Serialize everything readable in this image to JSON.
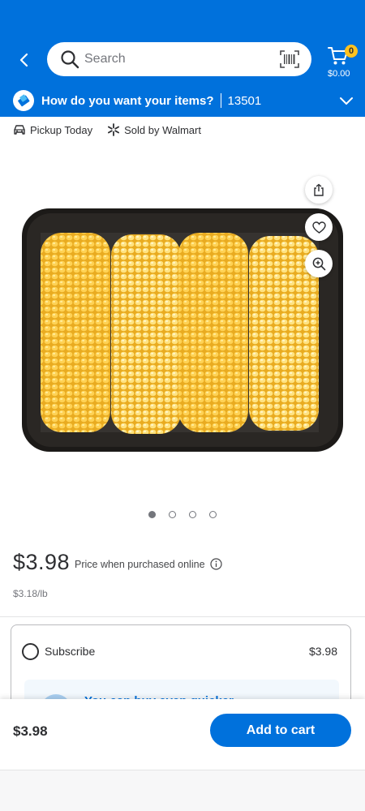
{
  "header": {
    "search_placeholder": "Search",
    "cart_count": "0",
    "cart_total": "$0.00"
  },
  "fulfillment": {
    "question": "How do you want your items?",
    "zip": "13501"
  },
  "info": {
    "pickup": "Pickup Today",
    "sold_by": "Sold by Walmart"
  },
  "gallery": {
    "image_count": 4,
    "active_index": 0,
    "icons": [
      "share-icon",
      "heart-icon",
      "zoom-icon"
    ]
  },
  "pricing": {
    "price": "$3.98",
    "note": "Price when purchased online",
    "unit_price": "$3.18/lb"
  },
  "subscribe": {
    "label": "Subscribe",
    "price": "$3.98",
    "promo_text": "You can buy even quicker"
  },
  "bottom": {
    "price": "$3.98",
    "add_label": "Add to cart"
  },
  "colors": {
    "brand_blue": "#0071dc",
    "badge_yellow": "#ffc220"
  }
}
